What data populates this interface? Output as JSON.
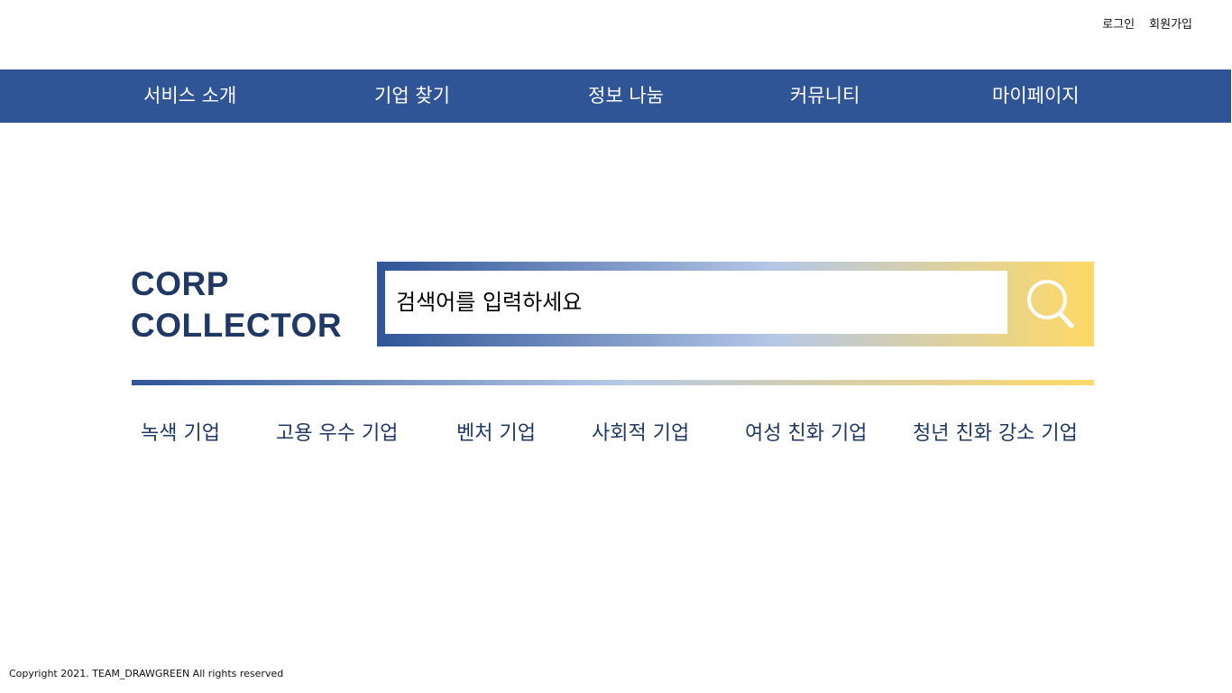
{
  "auth": {
    "login": "로그인",
    "signup": "회원가입"
  },
  "nav": {
    "items": [
      {
        "label": "서비스 소개"
      },
      {
        "label": "기업 찾기"
      },
      {
        "label": "정보 나눔"
      },
      {
        "label": "커뮤니티"
      },
      {
        "label": "마이페이지"
      }
    ],
    "background": "#2f5597"
  },
  "logo": {
    "line1": "CORP",
    "line2": "COLLECTOR",
    "color": "#1f3864"
  },
  "search": {
    "placeholder": "검색어를 입력하세요",
    "value": "",
    "icon": "search-icon",
    "gradient": [
      "#2f5597",
      "#b4c7e7",
      "#ffd966"
    ]
  },
  "categories": [
    {
      "label": "녹색 기업"
    },
    {
      "label": "고용 우수 기업"
    },
    {
      "label": "벤처 기업"
    },
    {
      "label": "사회적 기업"
    },
    {
      "label": "여성 친화 기업"
    },
    {
      "label": "청년 친화 강소 기업"
    }
  ],
  "footer": {
    "copyright": "Copyright 2021. TEAM_DRAWGREEN All rights reserved"
  }
}
